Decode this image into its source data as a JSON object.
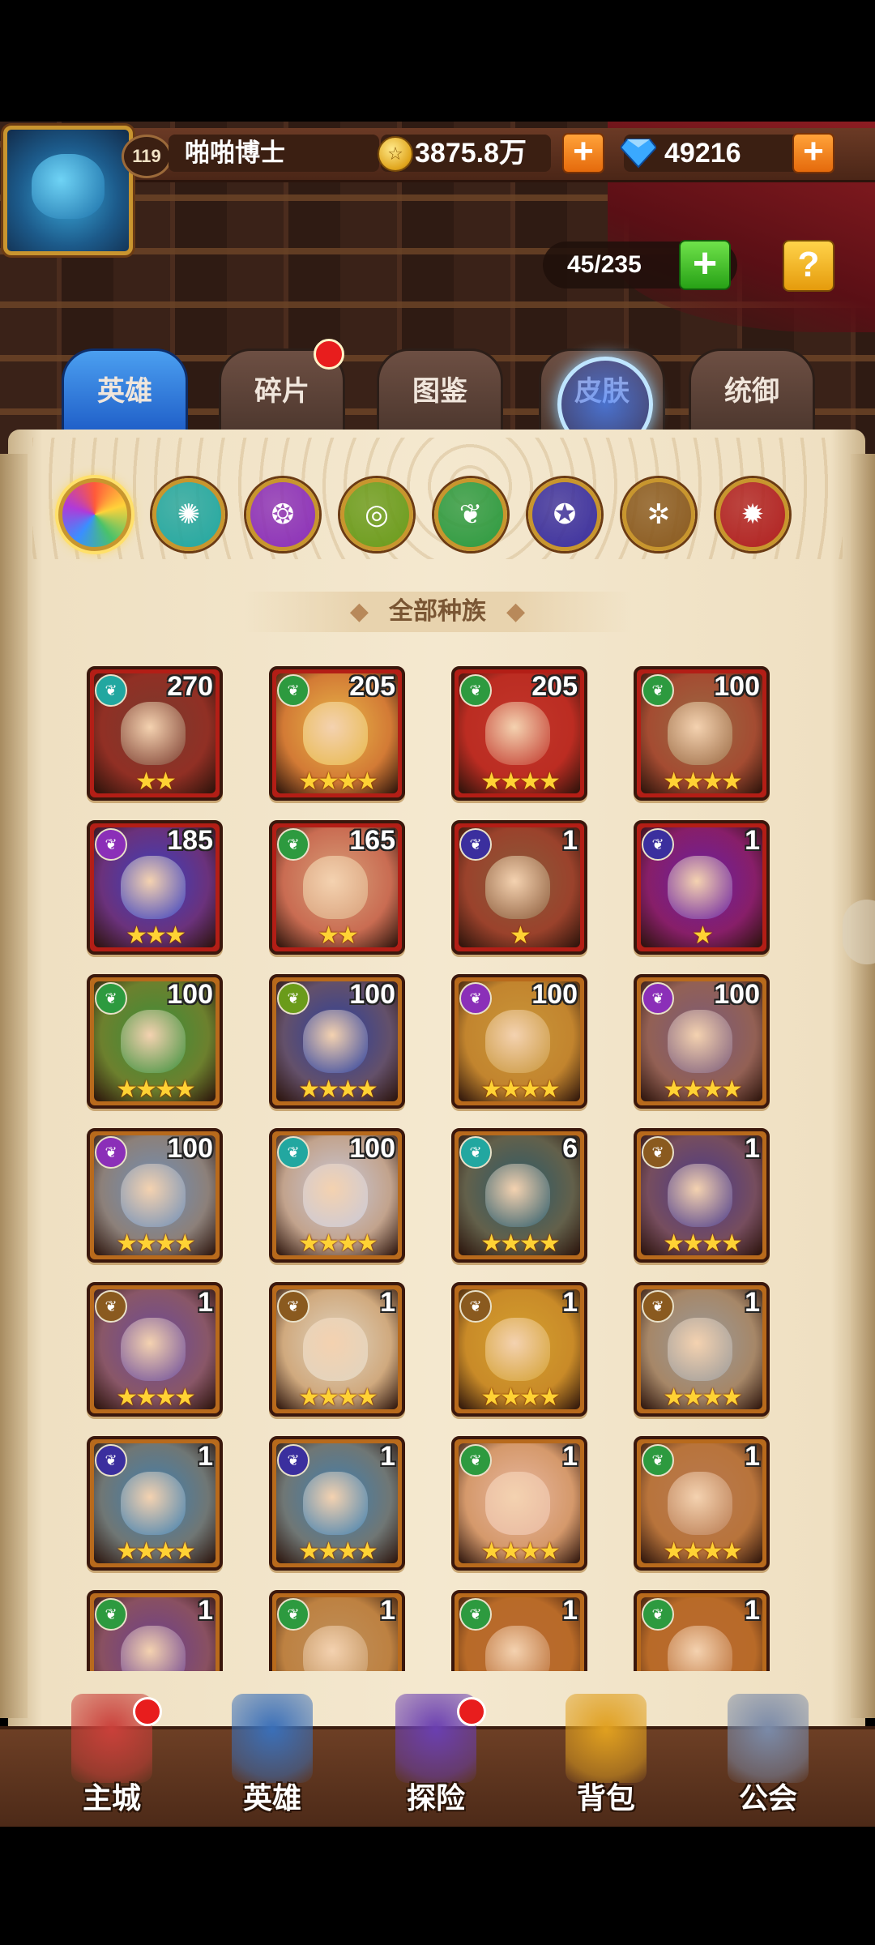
{
  "player": {
    "level": "119",
    "name": "啪啪博士"
  },
  "currency": {
    "gold": "3875.8万",
    "diamonds": "49216",
    "plus": "+"
  },
  "capacity": {
    "count": "45/235",
    "plus": "+",
    "help": "?"
  },
  "tabs": [
    {
      "label": "英雄",
      "active": true
    },
    {
      "label": "碎片",
      "badge": true
    },
    {
      "label": "图鉴"
    },
    {
      "label": "皮肤"
    },
    {
      "label": "统御"
    }
  ],
  "race_filters": [
    {
      "name": "all",
      "color": "#ff7a3a",
      "active": true
    },
    {
      "name": "water",
      "color": "#22a7a0"
    },
    {
      "name": "mystic",
      "color": "#8b2fb8"
    },
    {
      "name": "earth",
      "color": "#6a9b1a"
    },
    {
      "name": "forest",
      "color": "#2d9a3f"
    },
    {
      "name": "shadow",
      "color": "#3b2f9e"
    },
    {
      "name": "light",
      "color": "#8a5a1f"
    },
    {
      "name": "fire",
      "color": "#b02020"
    }
  ],
  "race_header": "全部种族",
  "heroes": [
    {
      "level": "270",
      "stars": "★★",
      "race_color": "#22a7a0",
      "frame": "#b31e16",
      "art": "#7a3b2e"
    },
    {
      "level": "205",
      "stars": "★★★★",
      "race_color": "#2d9a3f",
      "frame": "#b31e16",
      "art": "#e8b84a"
    },
    {
      "level": "205",
      "stars": "★★★★",
      "race_color": "#2d9a3f",
      "frame": "#b31e16",
      "art": "#c1362a"
    },
    {
      "level": "100",
      "stars": "★★★★",
      "race_color": "#2d9a3f",
      "frame": "#b31e16",
      "art": "#9a6a44"
    },
    {
      "level": "185",
      "stars": "★★★",
      "race_color": "#8b2fb8",
      "frame": "#b31e16",
      "art": "#3a3fc0"
    },
    {
      "level": "165",
      "stars": "★★",
      "race_color": "#2d9a3f",
      "frame": "#b31e16",
      "art": "#d8a07a"
    },
    {
      "level": "1",
      "stars": "★",
      "race_color": "#3b2f9e",
      "frame": "#b31e16",
      "art": "#8a5a3a"
    },
    {
      "level": "1",
      "stars": "★",
      "race_color": "#3b2f9e",
      "frame": "#b31e16",
      "art": "#6a1fa0"
    },
    {
      "level": "100",
      "stars": "★★★★",
      "race_color": "#2d9a3f",
      "frame": "#b86a1c",
      "art": "#3a8f3a"
    },
    {
      "level": "100",
      "stars": "★★★★",
      "race_color": "#6a9b1a",
      "frame": "#b86a1c",
      "art": "#2b3f9e"
    },
    {
      "level": "100",
      "stars": "★★★★",
      "race_color": "#8b2fb8",
      "frame": "#b86a1c",
      "art": "#c9963a"
    },
    {
      "level": "100",
      "stars": "★★★★",
      "race_color": "#8b2fb8",
      "frame": "#b86a1c",
      "art": "#7a5a7a"
    },
    {
      "level": "100",
      "stars": "★★★★",
      "race_color": "#8b2fb8",
      "frame": "#b86a1c",
      "art": "#6f8fb8"
    },
    {
      "level": "100",
      "stars": "★★★★",
      "race_color": "#22a7a0",
      "frame": "#b86a1c",
      "art": "#c9c9d8"
    },
    {
      "level": "6",
      "stars": "★★★★",
      "race_color": "#22a7a0",
      "frame": "#b86a1c",
      "art": "#2a5a6a"
    },
    {
      "level": "1",
      "stars": "★★★★",
      "race_color": "#8a5a1f",
      "frame": "#b86a1c",
      "art": "#4a3a8a"
    },
    {
      "level": "1",
      "stars": "★★★★",
      "race_color": "#8a5a1f",
      "frame": "#b86a1c",
      "art": "#6a4a9a"
    },
    {
      "level": "1",
      "stars": "★★★★",
      "race_color": "#8a5a1f",
      "frame": "#b86a1c",
      "art": "#e0d4c0"
    },
    {
      "level": "1",
      "stars": "★★★★",
      "race_color": "#8a5a1f",
      "frame": "#b86a1c",
      "art": "#d4a030"
    },
    {
      "level": "1",
      "stars": "★★★★",
      "race_color": "#8a5a1f",
      "frame": "#b86a1c",
      "art": "#9a9a9a"
    },
    {
      "level": "1",
      "stars": "★★★★",
      "race_color": "#3b2f9e",
      "frame": "#b86a1c",
      "art": "#3f7fb0"
    },
    {
      "level": "1",
      "stars": "★★★★",
      "race_color": "#3b2f9e",
      "frame": "#b86a1c",
      "art": "#3f7fb0"
    },
    {
      "level": "1",
      "stars": "★★★★",
      "race_color": "#2d9a3f",
      "frame": "#b86a1c",
      "art": "#e8b8a0"
    },
    {
      "level": "1",
      "stars": "★★★★",
      "race_color": "#2d9a3f",
      "frame": "#b86a1c",
      "art": "#b87a50"
    },
    {
      "level": "1",
      "stars": "★★★★",
      "race_color": "#2d9a3f",
      "frame": "#b86a1c",
      "art": "#6a3f8f"
    },
    {
      "level": "1",
      "stars": "★★★★",
      "race_color": "#2d9a3f",
      "frame": "#b86a1c",
      "art": "#c0905a"
    },
    {
      "level": "1",
      "stars": "★★★★",
      "race_color": "#2d9a3f",
      "frame": "#b86a1c",
      "art": "#b86a30"
    },
    {
      "level": "1",
      "stars": "★★★★",
      "race_color": "#2d9a3f",
      "frame": "#b86a1c",
      "art": "#b86a30"
    }
  ],
  "nav": [
    {
      "label": "主城",
      "badge": true,
      "icon": "castle-icon",
      "color": "#c9403a"
    },
    {
      "label": "英雄",
      "badge": false,
      "icon": "hero-icon",
      "color": "#3a6fb8"
    },
    {
      "label": "探险",
      "badge": true,
      "icon": "portal-icon",
      "color": "#6a3fb0"
    },
    {
      "label": "背包",
      "badge": false,
      "icon": "backpack-icon",
      "color": "#e0a020"
    },
    {
      "label": "公会",
      "badge": false,
      "icon": "guild-icon",
      "color": "#7a8aa8"
    }
  ]
}
